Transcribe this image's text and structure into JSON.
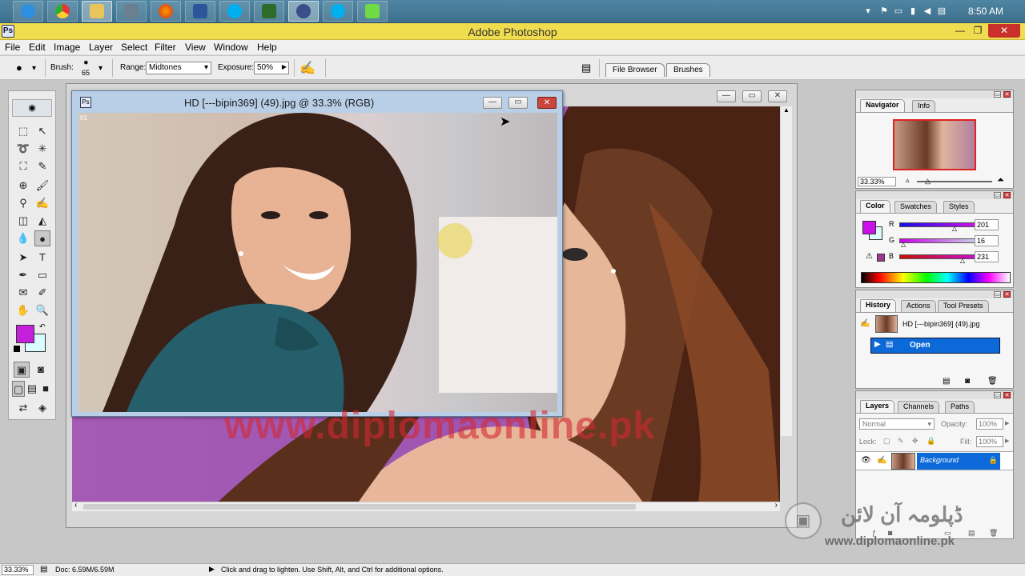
{
  "taskbar": {
    "apps": [
      "ie",
      "chrome",
      "explorer",
      "calculator",
      "firefox",
      "ms-word",
      "skype",
      "media-player",
      "camtasia",
      "skype-2",
      "upwork"
    ],
    "tray": {
      "time": "8:50 AM"
    }
  },
  "app": {
    "title": "Adobe Photoshop"
  },
  "menu": [
    "File",
    "Edit",
    "Image",
    "Layer",
    "Select",
    "Filter",
    "View",
    "Window",
    "Help"
  ],
  "options": {
    "brush_label": "Brush:",
    "brush_size": "65",
    "range_label": "Range:",
    "range_value": "Midtones",
    "exposure_label": "Exposure:",
    "exposure_value": "50%",
    "tab_file_browser": "File Browser",
    "tab_brushes": "Brushes"
  },
  "document_front": {
    "title": "HD [---bipin369] (49).jpg @ 33.3% (RGB)",
    "corner_tag": "01"
  },
  "watermark": {
    "url_overlay": "www.diplomaonline.pk",
    "urdu": "ڈپلومہ آن لائن",
    "footer_url": "www.diplomaonline.pk"
  },
  "navigator": {
    "tabs": [
      "Navigator",
      "Info"
    ],
    "zoom": "33.33%"
  },
  "color": {
    "tabs": [
      "Color",
      "Swatches",
      "Styles"
    ],
    "r_label": "R",
    "r_value": "201",
    "g_label": "G",
    "g_value": "16",
    "b_label": "B",
    "b_value": "231",
    "foreground_hex": "#c910e7",
    "background_hex": "#dafbff"
  },
  "history": {
    "tabs": [
      "History",
      "Actions",
      "Tool Presets"
    ],
    "snapshot": "HD [---bipin369] (49).jpg",
    "state": "Open"
  },
  "layers": {
    "tabs": [
      "Layers",
      "Channels",
      "Paths"
    ],
    "blend_mode": "Normal",
    "opacity_label": "Opacity:",
    "opacity_value": "100%",
    "lock_label": "Lock:",
    "fill_label": "Fill:",
    "fill_value": "100%",
    "layer_name": "Background"
  },
  "status": {
    "zoom": "33.33%",
    "doc": "Doc: 6.59M/6.59M",
    "hint": "Click and drag to lighten. Use Shift, Alt, and Ctrl for additional options."
  }
}
